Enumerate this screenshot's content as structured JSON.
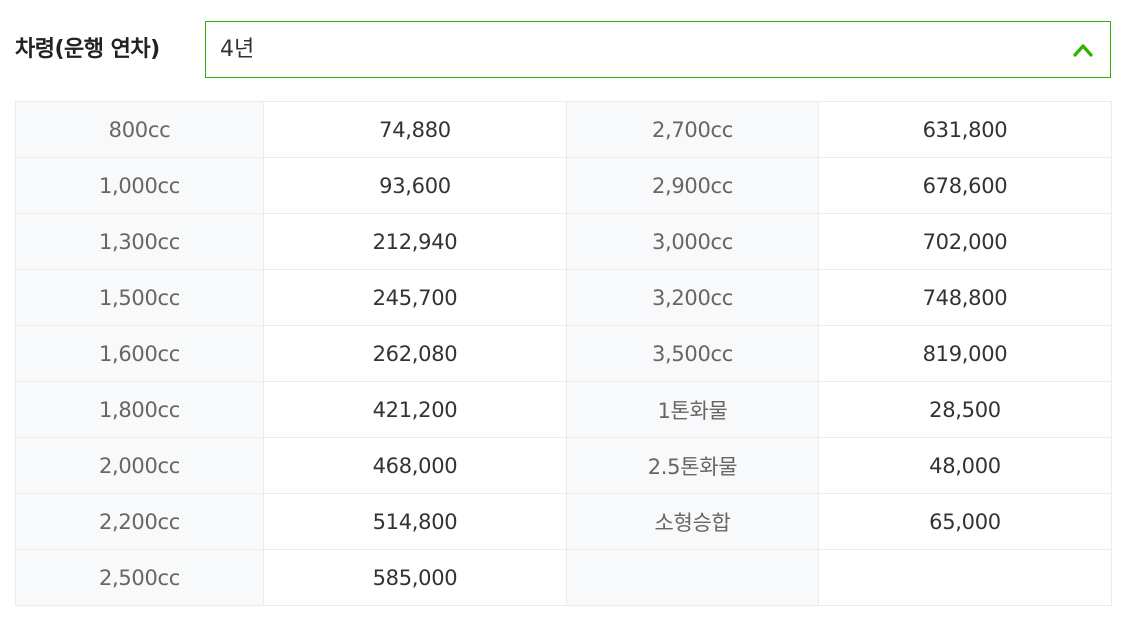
{
  "filter": {
    "label": "차령(운행 연차)",
    "selected_value": "4년"
  },
  "accent_color": "#2db400",
  "icons": {
    "select_toggle": "chevron-up-icon"
  },
  "rates": {
    "rows": [
      {
        "left_label": "800cc",
        "left_value": "74,880",
        "right_label": "2,700cc",
        "right_value": "631,800"
      },
      {
        "left_label": "1,000cc",
        "left_value": "93,600",
        "right_label": "2,900cc",
        "right_value": "678,600"
      },
      {
        "left_label": "1,300cc",
        "left_value": "212,940",
        "right_label": "3,000cc",
        "right_value": "702,000"
      },
      {
        "left_label": "1,500cc",
        "left_value": "245,700",
        "right_label": "3,200cc",
        "right_value": "748,800"
      },
      {
        "left_label": "1,600cc",
        "left_value": "262,080",
        "right_label": "3,500cc",
        "right_value": "819,000"
      },
      {
        "left_label": "1,800cc",
        "left_value": "421,200",
        "right_label": "1톤화물",
        "right_value": "28,500"
      },
      {
        "left_label": "2,000cc",
        "left_value": "468,000",
        "right_label": "2.5톤화물",
        "right_value": "48,000"
      },
      {
        "left_label": "2,200cc",
        "left_value": "514,800",
        "right_label": "소형승합",
        "right_value": "65,000"
      },
      {
        "left_label": "2,500cc",
        "left_value": "585,000",
        "right_label": "",
        "right_value": ""
      }
    ]
  }
}
